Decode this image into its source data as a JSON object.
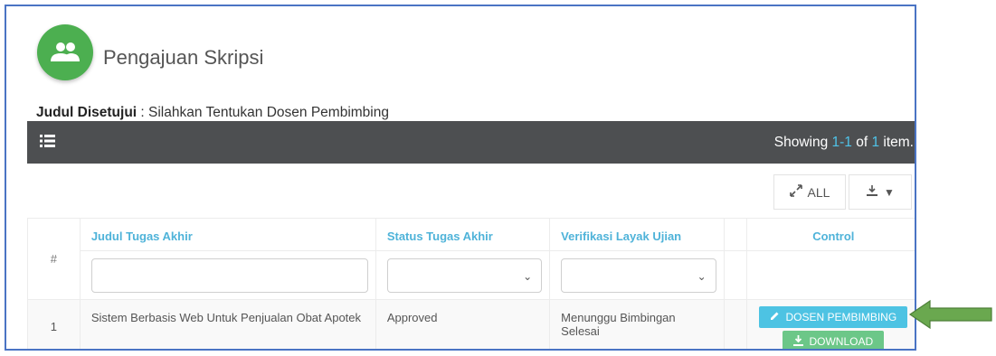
{
  "header": {
    "title": "Pengajuan Skripsi",
    "icon": "users-icon",
    "icon_color": "#4caf50"
  },
  "subtitle": {
    "label": "Judul Disetujui",
    "text": " : Silahkan Tentukan Dosen Pembimbing"
  },
  "toolbar": {
    "icon": "list-icon",
    "showing_prefix": "Showing ",
    "showing_range": "1-1",
    "showing_mid": " of ",
    "showing_total": "1",
    "showing_suffix": " item."
  },
  "actions": {
    "all_label": "ALL",
    "export_icon": "export-icon"
  },
  "table": {
    "columns": {
      "num": "#",
      "judul": "Judul Tugas Akhir",
      "status": "Status Tugas Akhir",
      "verifikasi": "Verifikasi Layak Ujian",
      "control": "Control"
    },
    "rows": [
      {
        "num": "1",
        "judul": "Sistem Berbasis Web Untuk Penjualan Obat Apotek",
        "status": "Approved",
        "verifikasi": "Menunggu Bimbingan Selesai",
        "dosen_button": "DOSEN PEMBIMBING",
        "download_button": "DOWNLOAD"
      }
    ]
  },
  "colors": {
    "accent_blue": "#4dc3e3",
    "accent_green": "#6cc788",
    "arrow_green": "#6aa84f"
  }
}
